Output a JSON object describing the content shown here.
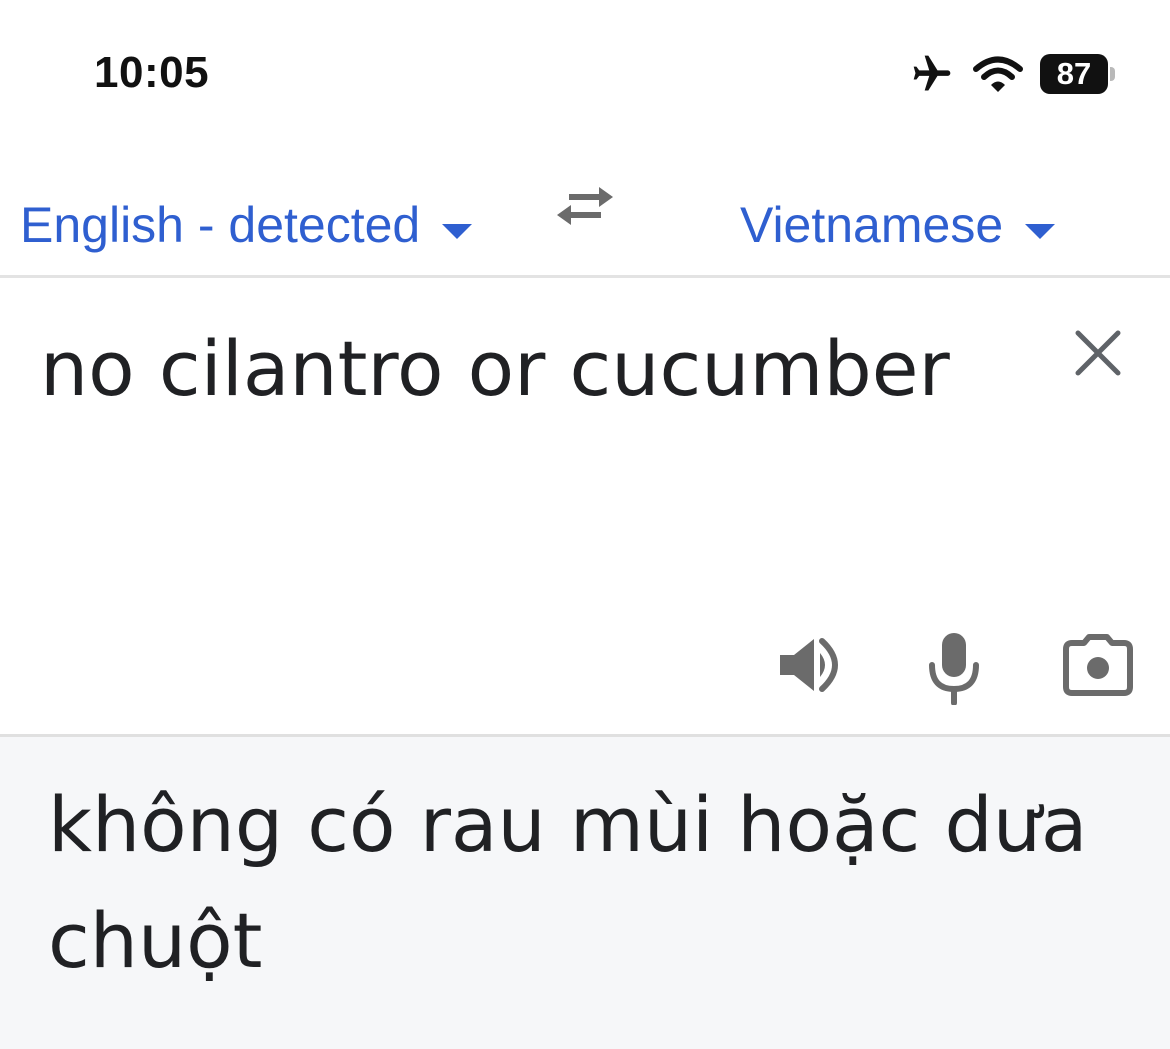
{
  "status_bar": {
    "time": "10:05",
    "battery_level": "87",
    "icons": [
      "airplane-icon",
      "wifi-icon",
      "battery-icon"
    ]
  },
  "language_bar": {
    "source_language": "English - detected",
    "target_language": "Vietnamese",
    "icons": [
      "chevron-down-icon",
      "swap-languages-icon"
    ]
  },
  "source": {
    "text": "no cilantro or cucumber",
    "icons": [
      "close-icon",
      "speaker-icon",
      "microphone-icon",
      "camera-icon"
    ]
  },
  "translation": {
    "text": "không có rau mùi hoặc dưa chuột"
  },
  "colors": {
    "accent": "#2f5fd0",
    "text": "#202124",
    "icon_gray": "#6b6b6b",
    "result_background": "#f6f7f9"
  }
}
